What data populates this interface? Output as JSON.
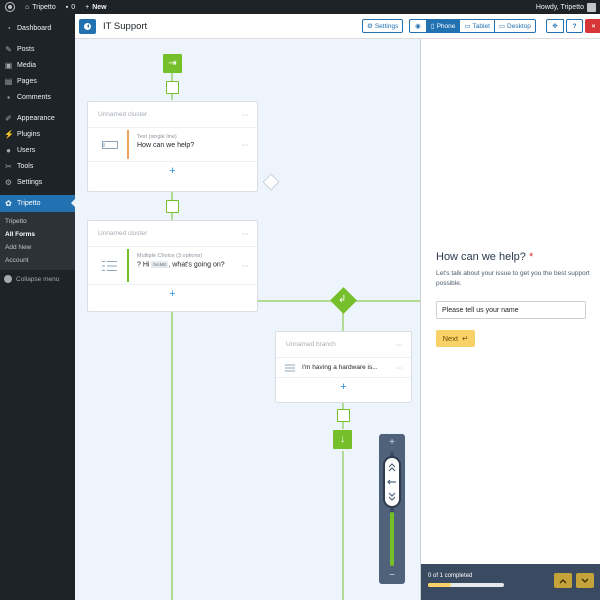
{
  "adminbar": {
    "site_name": "Tripetto",
    "comments_count": "0",
    "new_label": "New",
    "howdy": "Howdy, Tripetto"
  },
  "sidebar": {
    "items": [
      {
        "label": "Dashboard",
        "icon": "dashboard-icon"
      },
      {
        "label": "Posts",
        "icon": "pin-icon"
      },
      {
        "label": "Media",
        "icon": "media-icon"
      },
      {
        "label": "Pages",
        "icon": "pages-icon"
      },
      {
        "label": "Comments",
        "icon": "comment-icon"
      },
      {
        "label": "Appearance",
        "icon": "brush-icon"
      },
      {
        "label": "Plugins",
        "icon": "plugin-icon"
      },
      {
        "label": "Users",
        "icon": "user-icon"
      },
      {
        "label": "Tools",
        "icon": "wrench-icon"
      },
      {
        "label": "Settings",
        "icon": "settings-icon"
      }
    ],
    "active": {
      "label": "Tripetto",
      "icon": "tripetto-icon"
    },
    "submenu": [
      "Tripetto",
      "All Forms",
      "Add New",
      "Account"
    ],
    "collapse_label": "Collapse menu"
  },
  "header": {
    "title": "IT Support",
    "settings_label": "Settings",
    "devices": [
      "Phone",
      "Tablet",
      "Desktop"
    ],
    "active_device": "Phone",
    "help_label": "?",
    "close_label": "×"
  },
  "builder": {
    "clusters": [
      {
        "title": "Unnamed cluster",
        "block_type": "Text (single line)",
        "block_label": "How can we help?",
        "accent": "#f0a35e"
      },
      {
        "title": "Unnamed cluster",
        "block_type": "Multiple Choice (3 options)",
        "block_label_pre": "? Hi",
        "block_label_pill": "NAME",
        "block_label_post": ", what's going on?",
        "accent": "#75bf2a"
      }
    ],
    "branch": {
      "title": "Unnamed branch",
      "condition": "I'm having a hardware is..."
    },
    "menu_dots": "···",
    "add_symbol": "+"
  },
  "zoom": {
    "plus": "+",
    "minus": "−",
    "level": 0.47
  },
  "preview": {
    "question": "How can we help?",
    "required_mark": "*",
    "description": "Let's talk about your issue to get you the best support possible.",
    "input_placeholder": "Please tell us your name",
    "next_label": "Next",
    "progress_text": "0 of 1 completed",
    "progress": 0.3
  },
  "colors": {
    "accent_blue": "#2271b1",
    "flow_green": "#75bf2a",
    "next_yellow": "#f8d267",
    "danger_red": "#d63638"
  }
}
